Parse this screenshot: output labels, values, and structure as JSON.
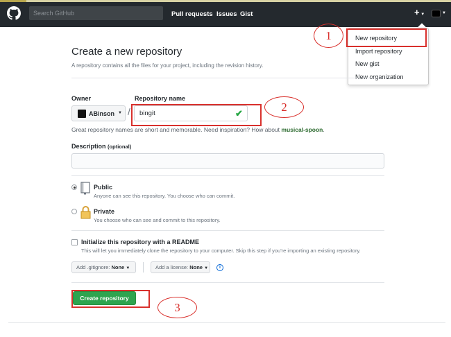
{
  "header": {
    "search_placeholder": "Search GitHub",
    "nav": [
      "Pull requests",
      "Issues",
      "Gist"
    ],
    "plus": "+"
  },
  "dropdown": {
    "items": [
      "New repository",
      "Import repository",
      "New gist",
      "New organization"
    ]
  },
  "annotations": [
    "1",
    "2",
    "3"
  ],
  "page": {
    "title": "Create a new repository",
    "subtitle": "A repository contains all the files for your project, including the revision history."
  },
  "owner": {
    "label": "Owner",
    "value": "ABinson"
  },
  "slash": "/",
  "repo": {
    "label": "Repository name",
    "value": "bingit"
  },
  "hint": {
    "text": "Great repository names are short and memorable. Need inspiration? How about ",
    "suggestion": "musical-spoon",
    "end": "."
  },
  "description": {
    "label": "Description",
    "optional": "(optional)"
  },
  "visibility": {
    "public": {
      "title": "Public",
      "desc": "Anyone can see this repository. You choose who can commit.",
      "selected": true
    },
    "private": {
      "title": "Private",
      "desc": "You choose who can see and commit to this repository.",
      "selected": false
    }
  },
  "readme": {
    "title": "Initialize this repository with a README",
    "desc": "This will let you immediately clone the repository to your computer. Skip this step if you're importing an existing repository.",
    "checked": false
  },
  "gitignore": {
    "label": "Add .gitignore:",
    "value": "None"
  },
  "license": {
    "label": "Add a license:",
    "value": "None"
  },
  "info_glyph": "i",
  "create_button": "Create repository",
  "colors": {
    "accent": "#2ea44f",
    "annotation": "#d9302c",
    "header": "#24292e"
  }
}
